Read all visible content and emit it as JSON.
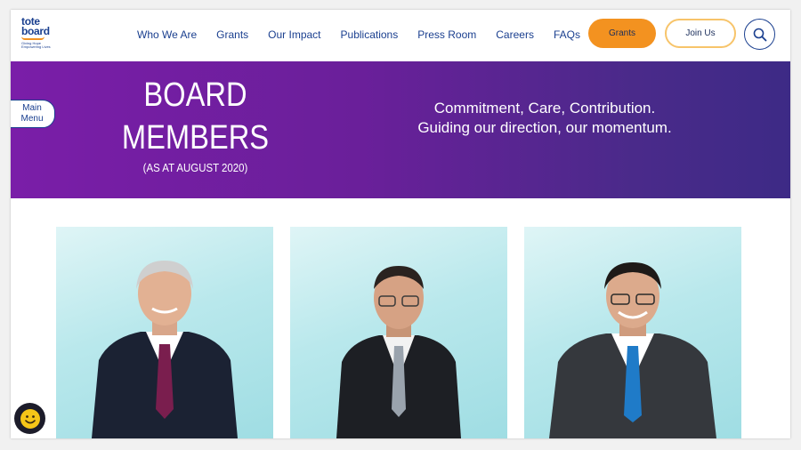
{
  "logo": {
    "line1": "tote",
    "line2": "board",
    "tagline1": "Giving Hope",
    "tagline2": "Empowering Lives"
  },
  "nav": {
    "items": [
      "Who We Are",
      "Grants",
      "Our Impact",
      "Publications",
      "Press Room",
      "Careers",
      "FAQs"
    ],
    "grants_button": "Grants",
    "join_button": "Join Us",
    "search_icon": "search-icon"
  },
  "banner": {
    "title_line1": "BOARD",
    "title_line2": "MEMBERS",
    "subtitle": "(AS AT AUGUST 2020)",
    "tagline_line1": "Commitment, Care, Contribution.",
    "tagline_line2": "Guiding our direction, our momentum."
  },
  "side_tab": {
    "line1": "Main",
    "line2": "Menu"
  },
  "colors": {
    "brand_blue": "#1a3f8f",
    "accent_orange": "#f39220",
    "banner_purple": "#6a1f9a"
  },
  "chat_icon": "smiley-chat-icon"
}
